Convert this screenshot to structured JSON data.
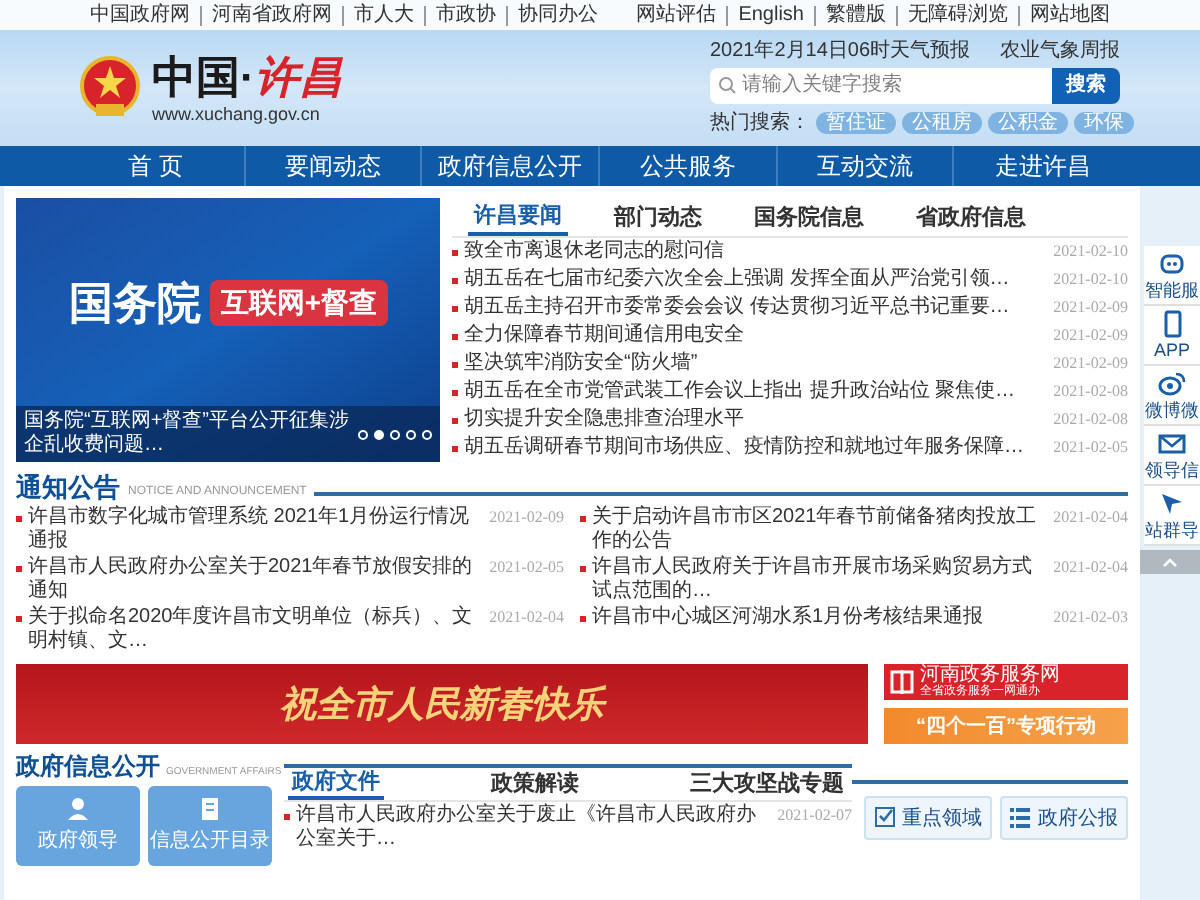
{
  "top_links_left": [
    "中国政府网",
    "河南省政府网",
    "市人大",
    "市政协",
    "协同办公"
  ],
  "top_links_right": [
    "网站评估",
    "English",
    "繁體版",
    "无障碍浏览",
    "网站地图"
  ],
  "header": {
    "site_title": "中国·",
    "site_title_city": "许昌",
    "site_url": "www.xuchang.gov.cn",
    "weather": "2021年2月14日06时天气预报",
    "agri_weather": "农业气象周报",
    "search": {
      "placeholder": "请输入关键字搜索",
      "button": "搜索"
    },
    "hot_label": "热门搜索：",
    "hot_tags": [
      "暂住证",
      "公租房",
      "公积金",
      "环保"
    ]
  },
  "nav": [
    "首 页",
    "要闻动态",
    "政府信息公开",
    "公共服务",
    "互动交流",
    "走进许昌"
  ],
  "carousel": {
    "banner_title": "国务院",
    "banner_tag": "互联网+督查",
    "caption": "国务院“互联网+督查”平台公开征集涉企乱收费问题…",
    "dots": [
      {
        "selected": false
      },
      {
        "selected": true
      },
      {
        "selected": false
      },
      {
        "selected": false
      },
      {
        "selected": false
      }
    ]
  },
  "news": {
    "tabs": [
      {
        "label": "许昌要闻",
        "selected": true
      },
      {
        "label": "部门动态",
        "selected": false
      },
      {
        "label": "国务院信息",
        "selected": false
      },
      {
        "label": "省政府信息",
        "selected": false
      }
    ],
    "items": [
      {
        "title": "致全市离退休老同志的慰问信",
        "date": "2021-02-10"
      },
      {
        "title": "胡五岳在七届市纪委六次全会上强调 发挥全面从严治党引领…",
        "date": "2021-02-10"
      },
      {
        "title": "胡五岳主持召开市委常委会会议 传达贯彻习近平总书记重要…",
        "date": "2021-02-09"
      },
      {
        "title": "全力保障春节期间通信用电安全",
        "date": "2021-02-09"
      },
      {
        "title": "坚决筑牢消防安全“防火墙”",
        "date": "2021-02-09"
      },
      {
        "title": "胡五岳在全市党管武装工作会议上指出 提升政治站位 聚焦使…",
        "date": "2021-02-08"
      },
      {
        "title": "切实提升安全隐患排查治理水平",
        "date": "2021-02-08"
      },
      {
        "title": "胡五岳调研春节期间市场供应、疫情防控和就地过年服务保障…",
        "date": "2021-02-05"
      }
    ]
  },
  "side_tools": [
    {
      "label": "智能服",
      "kind": "robot"
    },
    {
      "label": "APP",
      "kind": "phone"
    },
    {
      "label": "微博微",
      "kind": "weibo"
    },
    {
      "label": "领导信",
      "kind": "mail"
    },
    {
      "label": "站群导",
      "kind": "cursor"
    },
    {
      "kind": "top"
    }
  ],
  "notices": {
    "title": "通知公告",
    "subtitle": "NOTICE AND ANNOUNCEMENT",
    "left": [
      {
        "title": "许昌市数字化城市管理系统 2021年1月份运行情况通报",
        "date": "2021-02-09"
      },
      {
        "title": "许昌市人民政府办公室关于2021年春节放假安排的通知",
        "date": "2021-02-05"
      },
      {
        "title": "关于拟命名2020年度许昌市文明单位（标兵）、文明村镇、文…",
        "date": "2021-02-04"
      }
    ],
    "right": [
      {
        "title": "关于启动许昌市市区2021年春节前储备猪肉投放工作的公告",
        "date": "2021-02-04"
      },
      {
        "title": "许昌市人民政府关于许昌市开展市场采购贸易方式试点范围的…",
        "date": "2021-02-04"
      },
      {
        "title": "许昌市中心城区河湖水系1月份考核结果通报",
        "date": "2021-02-03"
      }
    ]
  },
  "banners": {
    "greeting": "祝全市人民新春快乐",
    "service_title": "河南政务服务网",
    "service_sub": "全省政务服务一网通办",
    "campaign": "“四个一百”专项行动"
  },
  "gov": {
    "title": "政府信息公开",
    "subtitle": "GOVERNMENT AFFAIRS",
    "tiles": [
      {
        "label": "政府领导",
        "kind": "person"
      },
      {
        "label": "信息公开目录",
        "kind": "book"
      }
    ],
    "tabs": [
      {
        "label": "政府文件",
        "selected": true
      },
      {
        "label": "政策解读",
        "selected": false
      },
      {
        "label": "三大攻坚战专题",
        "selected": false
      }
    ],
    "items": [
      {
        "title": "许昌市人民政府办公室关于废止《许昌市人民政府办公室关于…",
        "date": "2021-02-07"
      }
    ],
    "buttons": [
      {
        "label": "重点领域",
        "kind": "check"
      },
      {
        "label": "政府公报",
        "kind": "list"
      }
    ]
  }
}
